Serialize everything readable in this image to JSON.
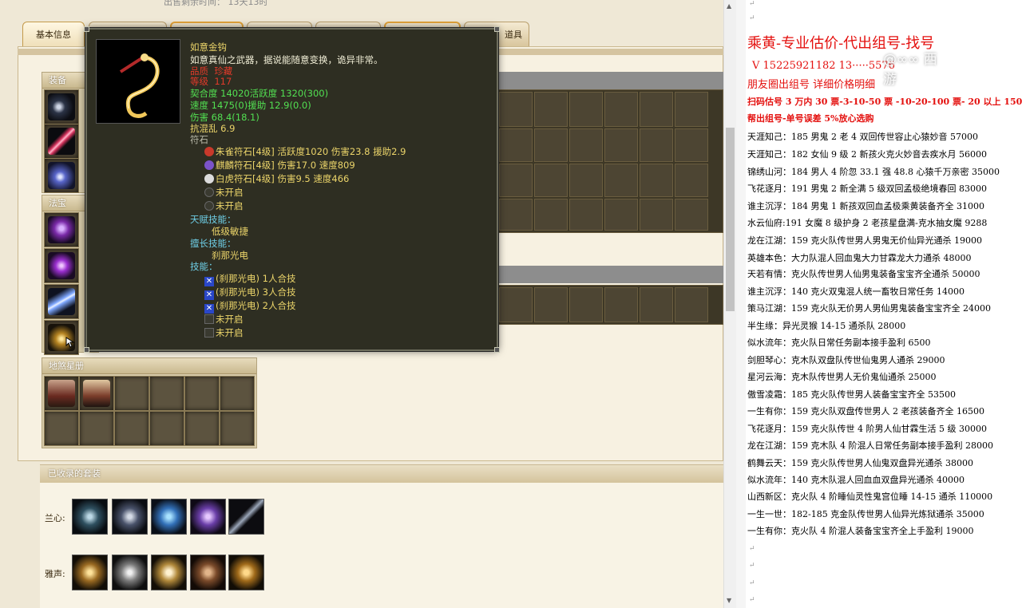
{
  "topline": "出售剩余时间：  13天13时",
  "tabs": [
    {
      "label": "基本信息"
    },
    {
      "label": ""
    },
    {
      "label": ""
    },
    {
      "label": ""
    },
    {
      "label": ""
    },
    {
      "label": ""
    },
    {
      "label": "道具"
    }
  ],
  "sections": {
    "equipment": "装备",
    "fabao": "法宝",
    "dishaxingce": "地煞星册",
    "suits_title": "已收录的套装"
  },
  "suits": [
    {
      "label": "兰心:",
      "icons": [
        "bracelet-icon",
        "robe-icon",
        "mask-icon",
        "ring-icon",
        "blade-icon"
      ]
    },
    {
      "label": "雅声:",
      "icons": [
        "necklace-icon",
        "bead-chain-icon",
        "face-mask-icon",
        "armor-icon",
        "crown-icon"
      ]
    }
  ],
  "tooltip": {
    "name": "如意金钩",
    "desc": "如意真仙之武器，据说能随意变换，诡异非常。",
    "quality_label": "品质",
    "quality_value": "珍藏",
    "level_label": "等级",
    "level_value": "117",
    "stat1": "契合度    14020活跃度  1320(300)",
    "stat2": "速度     1475(0)援助    12.9(0.0)",
    "stat3": "伤害    68.4(18.1)",
    "stat4": "抗混乱 6.9",
    "runes_title": "符石",
    "runes": [
      {
        "text": "朱雀符石[4级] 活跃度1020 伤害23.8 援助2.9",
        "color": "#c8392b"
      },
      {
        "text": "麒麟符石[4级] 伤害17.0 速度809",
        "color": "#7b53c9"
      },
      {
        "text": "白虎符石[4级] 伤害9.5 速度466",
        "color": "#dcdcdc"
      },
      {
        "text": "未开启",
        "color": ""
      },
      {
        "text": "未开启",
        "color": ""
      }
    ],
    "talent_title": "天赋技能：",
    "talent_value": "低级敏捷",
    "special_title": "擅长技能：",
    "special_value": "刹那光电",
    "skills_title": "技能：",
    "skills": [
      {
        "text": "(刹那光电) 1人合技",
        "locked": false
      },
      {
        "text": "(刹那光电) 3人合技",
        "locked": false
      },
      {
        "text": "(刹那光电) 2人合技",
        "locked": false
      },
      {
        "text": "未开启",
        "locked": true
      },
      {
        "text": "未开启",
        "locked": true
      }
    ]
  },
  "doc": {
    "head1": "乘黄-专业估价-代出组号-找号",
    "head2": "V 15225921182   13·····5576",
    "head3": "朋友圈出组号     详细价格明细",
    "red1": "扫码估号 3 万内 30 票-3-10-50 票  -10-20-100 票- 20 以上 150",
    "red2": "帮出组号-单号误差 5%放心选购",
    "watermark": "@∞∞ 西游",
    "lines": [
      "天涯知己：185 男鬼 2 老 4 双回传世容止心猿妙音 57000",
      "天涯知己：182 女仙 9 级 2 新孩火克火妙音去疾水月 56000",
      "锦绣山河：184 男人 4 阶忽 33.1 强 48.8 心猿千万亲密 35000",
      "飞花逐月：191 男鬼 2 新全满 5 级双回孟极绝境春回 83000",
      "谁主沉浮：184 男鬼 1 新孩双回血孟极乘黄装备齐全 31000",
      "水云仙府:191 女魔 8 级护身 2 老孩星盘满-克水抽女魔 9288",
      "龙在江湖：159 克火队传世男人男鬼无价仙异光通杀 19000",
      "英雄本色：大力队混人回血鬼大力甘霖龙大力通杀 48000",
      "天若有情：克火队传世男人仙男鬼装备宝宝齐全通杀 50000",
      "谁主沉浮：140 克火双鬼混人统一畜牧日常任务 14000",
      "策马江湖：159 克火队无价男人男仙男鬼装备宝宝齐全 24000",
      "半生缘：异光灵猴 14-15 通杀队 28000",
      "似水流年：克火队日常任务副本接手盈利 6500",
      "剑胆琴心：克木队双盘队传世仙鬼男人通杀 29000",
      "星河云海：克木队传世男人无价鬼仙通杀 25000",
      "傲雪凌霜：185 克火队传世男人装备宝宝齐全 53500",
      "一生有你：159 克火队双盘传世男人 2 老孩装备齐全 16500",
      "飞花逐月：159 克火队传世 4 阶男人仙甘霖生活 5 级 30000",
      "龙在江湖：159 克木队 4 阶混人日常任务副本接手盈利 28000",
      "鹤舞云天：159 克火队传世男人仙鬼双盘异光通杀 38000",
      "似水流年：140 克木队混人回血血双盘异光通杀 40000",
      "山西新区：克火队 4 阶睡仙灵性鬼宫位睡 14-15 通杀 110000",
      "一生一世：182-185 克金队传世男人仙异光炼狱通杀 35000",
      "一生有你：克火队 4 阶混人装备宝宝齐全上手盈利 19000"
    ]
  }
}
